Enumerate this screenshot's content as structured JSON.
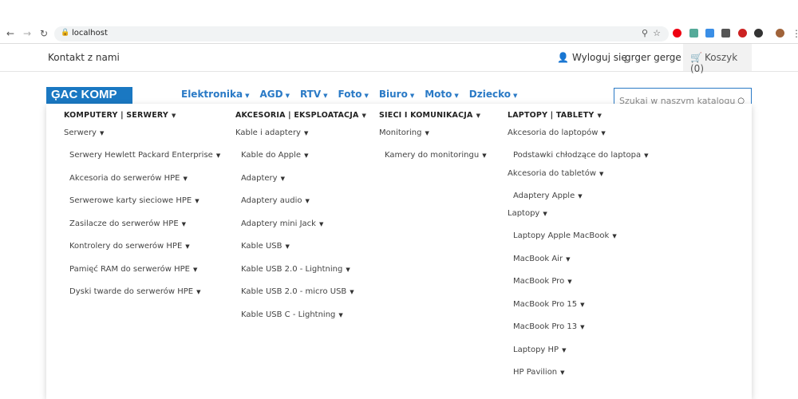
{
  "browser": {
    "url": "localhost"
  },
  "topbar": {
    "contact": "Kontakt z nami",
    "logout": "Wyloguj się",
    "user": "grger gerge",
    "cart": "Koszyk (0)"
  },
  "logo": "ĢAC KOMP",
  "nav": [
    "Elektronika",
    "AGD",
    "RTV",
    "Foto",
    "Biuro",
    "Moto",
    "Dziecko"
  ],
  "search": {
    "placeholder": "Szukaj w naszym katalogu"
  },
  "menu": [
    {
      "title": "KOMPUTERY | SERWERY",
      "items": [
        {
          "t": "l1",
          "label": "Serwery"
        },
        {
          "t": "sub",
          "label": "Serwery Hewlett Packard Enterprise"
        },
        {
          "t": "sub",
          "label": "Akcesoria do serwerów HPE"
        },
        {
          "t": "sub",
          "label": "Serwerowe karty sieciowe HPE"
        },
        {
          "t": "sub",
          "label": "Zasilacze do serwerów HPE"
        },
        {
          "t": "sub",
          "label": "Kontrolery do serwerów HPE"
        },
        {
          "t": "sub",
          "label": "Pamięć RAM do serwerów HPE"
        },
        {
          "t": "sub",
          "label": "Dyski twarde do serwerów HPE"
        }
      ]
    },
    {
      "title": "AKCESORIA | EKSPLOATACJA",
      "items": [
        {
          "t": "l1",
          "label": "Kable i adaptery"
        },
        {
          "t": "sub",
          "label": "Kable do Apple"
        },
        {
          "t": "sub",
          "label": "Adaptery"
        },
        {
          "t": "sub",
          "label": "Adaptery audio"
        },
        {
          "t": "sub",
          "label": "Adaptery mini Jack"
        },
        {
          "t": "sub",
          "label": "Kable USB"
        },
        {
          "t": "sub",
          "label": "Kable USB 2.0 - Lightning"
        },
        {
          "t": "sub",
          "label": "Kable USB 2.0 - micro USB"
        },
        {
          "t": "sub",
          "label": "Kable USB C - Lightning"
        }
      ]
    },
    {
      "title": "SIECI I KOMUNIKACJA",
      "items": [
        {
          "t": "l1",
          "label": "Monitoring"
        },
        {
          "t": "sub",
          "label": "Kamery do monitoringu"
        }
      ]
    },
    {
      "title": "LAPTOPY | TABLETY",
      "items": [
        {
          "t": "l1",
          "label": "Akcesoria do laptopów"
        },
        {
          "t": "sub",
          "label": "Podstawki chłodzące do laptopa"
        },
        {
          "t": "l1",
          "label": "Akcesoria do tabletów"
        },
        {
          "t": "sub",
          "label": "Adaptery Apple"
        },
        {
          "t": "l1",
          "label": "Laptopy"
        },
        {
          "t": "sub",
          "label": "Laptopy Apple MacBook"
        },
        {
          "t": "sub",
          "label": "MacBook Air"
        },
        {
          "t": "sub",
          "label": "MacBook Pro"
        },
        {
          "t": "sub",
          "label": "MacBook Pro 15"
        },
        {
          "t": "sub",
          "label": "MacBook Pro 13"
        },
        {
          "t": "sub",
          "label": "Laptopy HP"
        },
        {
          "t": "sub",
          "label": "HP Pavilion"
        }
      ]
    }
  ]
}
